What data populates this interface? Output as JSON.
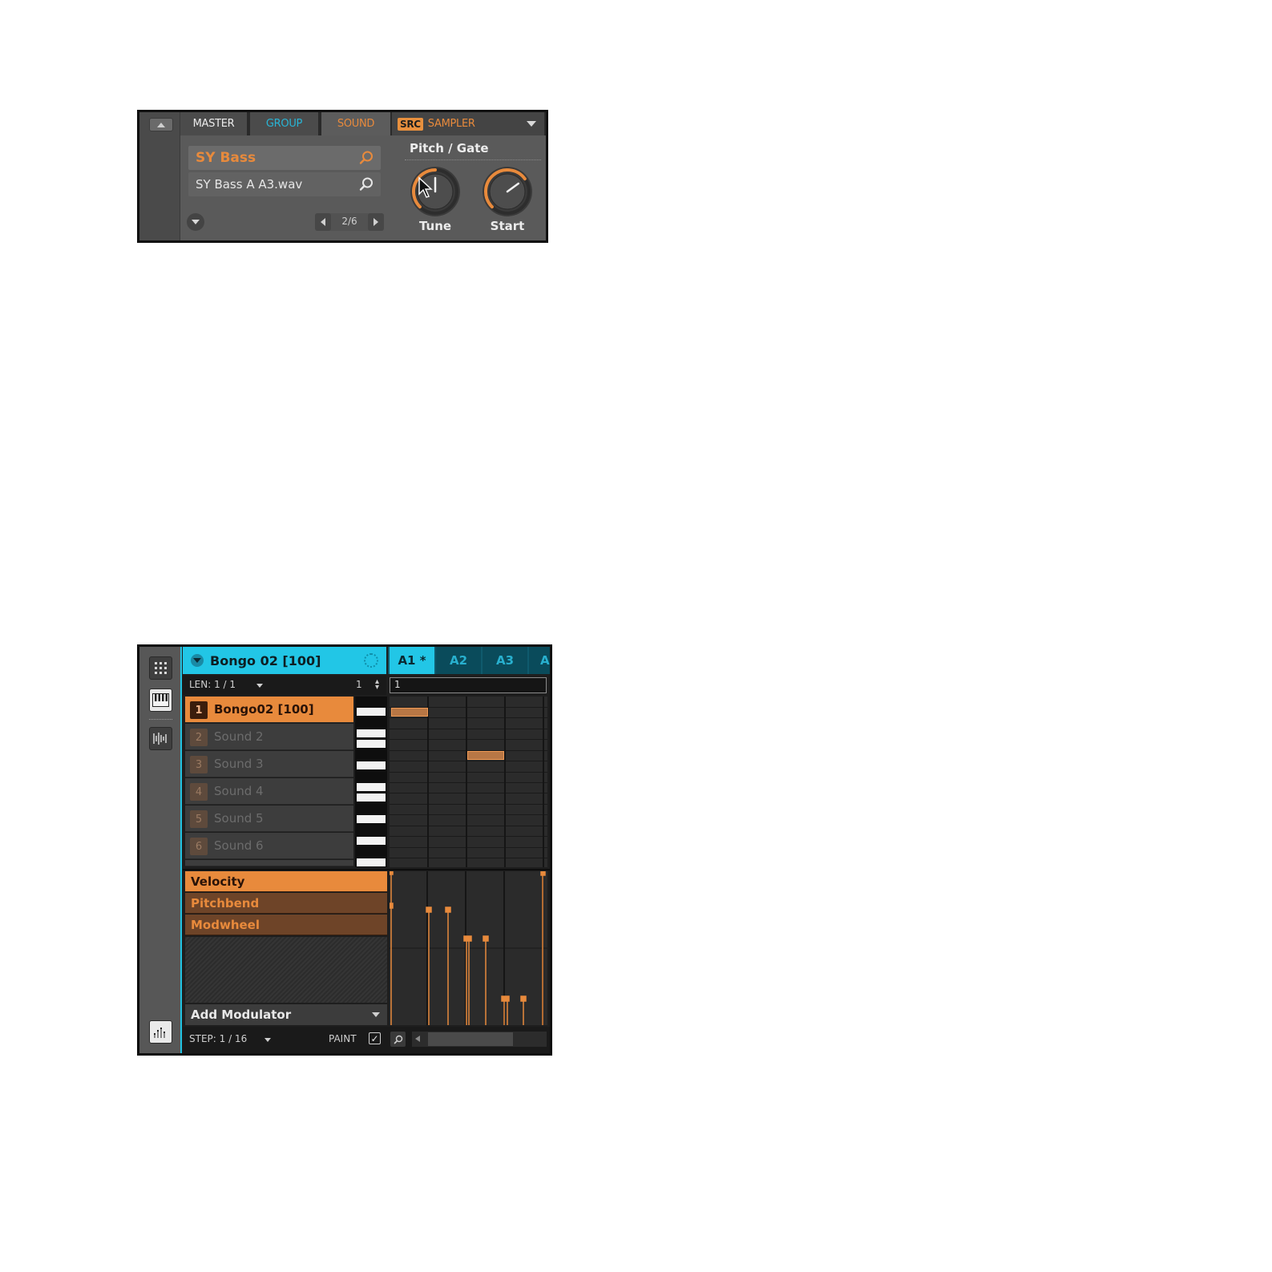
{
  "control_area": {
    "tabs": {
      "master": "MASTER",
      "group": "GROUP",
      "sound": "SOUND",
      "src_badge": "SRC",
      "src_module": "SAMPLER"
    },
    "preset_name": "SY Bass",
    "sample_name": "SY Bass A A3.wav",
    "page_indicator": "2/6",
    "section_title": "Pitch / Gate",
    "knobs": [
      {
        "label": "Tune",
        "value_fraction": 0.5
      },
      {
        "label": "Start",
        "value_fraction": 0.7
      }
    ]
  },
  "pattern_editor": {
    "header_title": "Bongo 02 [100]",
    "pattern_tabs": [
      "A1 *",
      "A2",
      "A3",
      "A"
    ],
    "active_pattern": "A1 *",
    "length_label": "LEN: 1 / 1",
    "length_value": "1",
    "timeline_start": "1",
    "sounds": [
      {
        "num": "1",
        "name": "Bongo02 [100]",
        "selected": true
      },
      {
        "num": "2",
        "name": "Sound 2",
        "selected": false
      },
      {
        "num": "3",
        "name": "Sound 3",
        "selected": false
      },
      {
        "num": "4",
        "name": "Sound 4",
        "selected": false
      },
      {
        "num": "5",
        "name": "Sound 5",
        "selected": false
      },
      {
        "num": "6",
        "name": "Sound 6",
        "selected": false
      }
    ],
    "modulation_lanes": [
      "Velocity",
      "Pitchbend",
      "Modwheel"
    ],
    "selected_lane": "Velocity",
    "add_modulator": "Add Modulator",
    "step_label": "STEP: 1 / 16",
    "paint_label": "PAINT",
    "paint_checked": true
  },
  "colors": {
    "accent_orange": "#e88a3c",
    "accent_cyan": "#22c6e6",
    "group_blue": "#29b4d4"
  },
  "icons": [
    "collapse-up-icon",
    "search-icon",
    "chevron-down-icon",
    "arrow-left-icon",
    "arrow-right-icon",
    "grid-view-icon",
    "keyboard-view-icon",
    "sampler-view-icon",
    "modulation-view-icon",
    "zoom-icon",
    "mouse-cursor-icon"
  ]
}
